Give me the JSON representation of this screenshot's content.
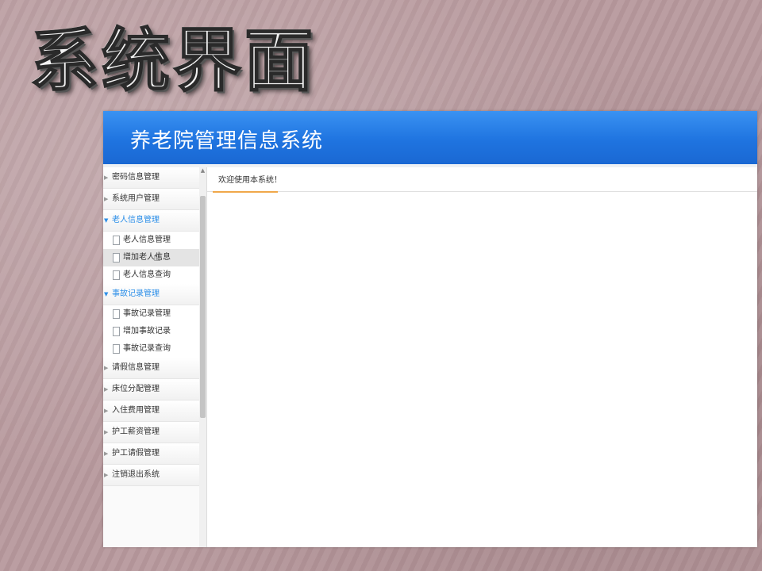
{
  "slide": {
    "title": "系统界面"
  },
  "app": {
    "title": "养老院管理信息系统",
    "colors": {
      "header": "#1f74e0",
      "tab_accent": "#f0a84a",
      "active_menu": "#2b8ee8"
    }
  },
  "sidebar": {
    "groups": [
      {
        "label": "密码信息管理"
      },
      {
        "label": "系统用户管理"
      },
      {
        "label": "老人信息管理",
        "items": [
          {
            "label": "老人信息管理"
          },
          {
            "label": "增加老人信息"
          },
          {
            "label": "老人信息查询"
          }
        ]
      },
      {
        "label": "事故记录管理",
        "items": [
          {
            "label": "事故记录管理"
          },
          {
            "label": "增加事故记录"
          },
          {
            "label": "事故记录查询"
          }
        ]
      },
      {
        "label": "请假信息管理"
      },
      {
        "label": "床位分配管理"
      },
      {
        "label": "入住费用管理"
      },
      {
        "label": "护工薪资管理"
      },
      {
        "label": "护工请假管理"
      },
      {
        "label": "注销退出系统"
      }
    ]
  },
  "main": {
    "tabs": [
      {
        "label": "欢迎使用本系统！"
      }
    ]
  }
}
